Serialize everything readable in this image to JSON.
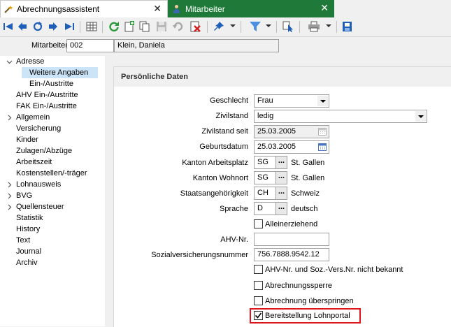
{
  "tabs": [
    {
      "label": "Abrechnungsassistent",
      "icon": "wand-icon",
      "active": false
    },
    {
      "label": "Mitarbeiter",
      "icon": "person-icon",
      "active": true
    }
  ],
  "tab_close_glyph": "✕",
  "toolbar": {
    "icons": [
      "first-record-icon",
      "previous-record-icon",
      "refresh-nav-icon",
      "next-record-icon",
      "last-record-icon",
      "grid-view-icon",
      "reload-icon",
      "new-record-icon",
      "copy-record-icon",
      "save-icon",
      "undo-icon",
      "delete-icon",
      "pin-icon",
      "filter-icon",
      "select-cursor-icon",
      "print-icon",
      "export-icon"
    ]
  },
  "header": {
    "employee_label": "Mitarbeiter",
    "employee_number": "002",
    "employee_name": "Klein, Daniela"
  },
  "nav": {
    "items": [
      {
        "label": "Adresse",
        "expandable": true,
        "expanded": true,
        "level": 0
      },
      {
        "label": "Weitere Angaben",
        "level": 1,
        "selected": true
      },
      {
        "label": "Ein-/Austritte",
        "level": 1
      },
      {
        "label": "AHV Ein-/Austritte",
        "level": 0
      },
      {
        "label": "FAK Ein-/Austritte",
        "level": 0
      },
      {
        "label": "Allgemein",
        "expandable": true,
        "level": 0
      },
      {
        "label": "Versicherung",
        "level": 0
      },
      {
        "label": "Kinder",
        "level": 0
      },
      {
        "label": "Zulagen/Abzüge",
        "level": 0
      },
      {
        "label": "Arbeitszeit",
        "level": 0
      },
      {
        "label": "Kostenstellen/-träger",
        "level": 0
      },
      {
        "label": "Lohnausweis",
        "expandable": true,
        "level": 0
      },
      {
        "label": "BVG",
        "expandable": true,
        "level": 0
      },
      {
        "label": "Quellensteuer",
        "expandable": true,
        "level": 0
      },
      {
        "label": "Statistik",
        "level": 0
      },
      {
        "label": "History",
        "level": 0
      },
      {
        "label": "Text",
        "level": 0
      },
      {
        "label": "Journal",
        "level": 0
      },
      {
        "label": "Archiv",
        "level": 0
      }
    ]
  },
  "section_title": "Persönliche Daten",
  "form": {
    "geschlecht": {
      "label": "Geschlecht",
      "value": "Frau"
    },
    "zivilstand": {
      "label": "Zivilstand",
      "value": "ledig"
    },
    "zivilstand_seit": {
      "label": "Zivilstand seit",
      "value": "25.03.2005"
    },
    "geburtsdatum": {
      "label": "Geburtsdatum",
      "value": "25.03.2005"
    },
    "kanton_arbeitsplatz": {
      "label": "Kanton Arbeitsplatz",
      "code": "SG",
      "name": "St. Gallen"
    },
    "kanton_wohnort": {
      "label": "Kanton Wohnort",
      "code": "SG",
      "name": "St. Gallen"
    },
    "staatsangehoerigkeit": {
      "label": "Staatsangehörigkeit",
      "code": "CH",
      "name": "Schweiz"
    },
    "sprache": {
      "label": "Sprache",
      "code": "D",
      "name": "deutsch"
    },
    "dots_label": "...",
    "alleinerziehend": {
      "label": "Alleinerziehend",
      "checked": false
    },
    "ahv_nr": {
      "label": "AHV-Nr.",
      "value": ""
    },
    "sozialversicherungsnummer": {
      "label": "Sozialversicherungsnummer",
      "value": "756.7888.9542.12"
    },
    "ahv_unbekannt": {
      "label": "AHV-Nr. und Soz.-Vers.Nr. nicht bekannt",
      "checked": false
    },
    "abrechnungssperre": {
      "label": "Abrechnungssperre",
      "checked": false
    },
    "abrechnung_ueberspringen": {
      "label": "Abrechnung überspringen",
      "checked": false
    },
    "bereitstellung_lohnportal": {
      "label": "Bereitstellung Lohnportal",
      "checked": true
    }
  },
  "colors": {
    "active_tab": "#1f7a3a",
    "selection": "#cce4f7",
    "highlight_box": "#e0141e",
    "nav_blue": "#1f5fb8"
  }
}
